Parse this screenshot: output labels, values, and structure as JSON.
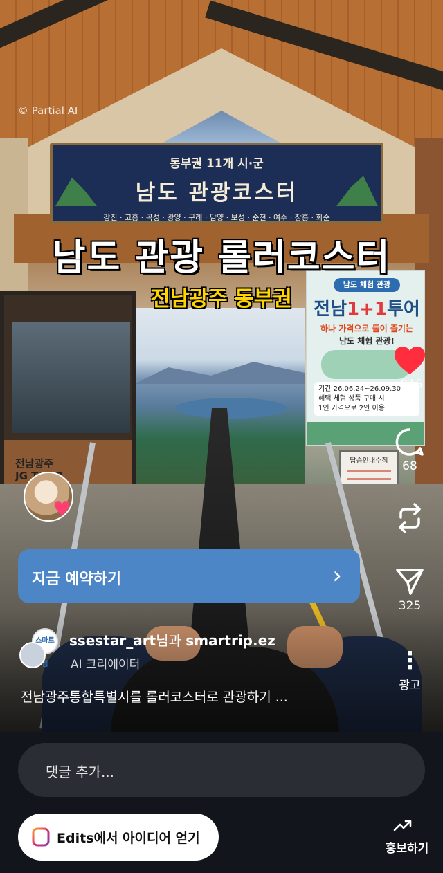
{
  "video": {
    "watermark": "© Partial AI",
    "sign": {
      "top": "동부권 11개 시·군",
      "main": "남도 관광코스터",
      "sub": "강진 · 고흥 · 곡성 · 광양 · 구례 · 담양 · 보성 · 순천 · 여수 · 장흥 · 화순"
    },
    "headline": "남도 관광 롤러코스터",
    "subhead": "전남광주 동부권",
    "booth_logo_line1": "전남광주",
    "booth_logo_line2": "JG TOUR",
    "poster": {
      "badge": "남도 체험 관광",
      "title_a": "전남",
      "title_b": "1+1",
      "title_c": "투어",
      "line1": "하나 가격으로 둘이 즐기는",
      "line2": "남도 체험 관광!",
      "info1": "기간  26.06.24~26.09.30",
      "info2": "혜택  체험 상품 구매 시",
      "info3": "1인 가격으로 2인 이용"
    },
    "infoboard_title": "탑승안내수칙"
  },
  "cta": {
    "label": "지금 예약하기"
  },
  "author": {
    "badge_text": "스마트립",
    "name_primary": "ssestar_art",
    "joiner": "님과 ",
    "name_secondary": "smartrip.ez",
    "sub": "AI 크리에이터"
  },
  "caption": "전남광주통합특별시를 롤러코스터로 관광하기 ...",
  "actions": {
    "likes": ",015",
    "comments": "68",
    "shares": "325",
    "more_label": "광고"
  },
  "bottom": {
    "comment_placeholder": "댓글 추가...",
    "edits_label": "Edits에서 아이디어 얻기",
    "promote_label": "홍보하기"
  },
  "colors": {
    "cta": "#4d86c7",
    "heart": "#ff2d3d",
    "bottom_bar": "#12151b"
  }
}
